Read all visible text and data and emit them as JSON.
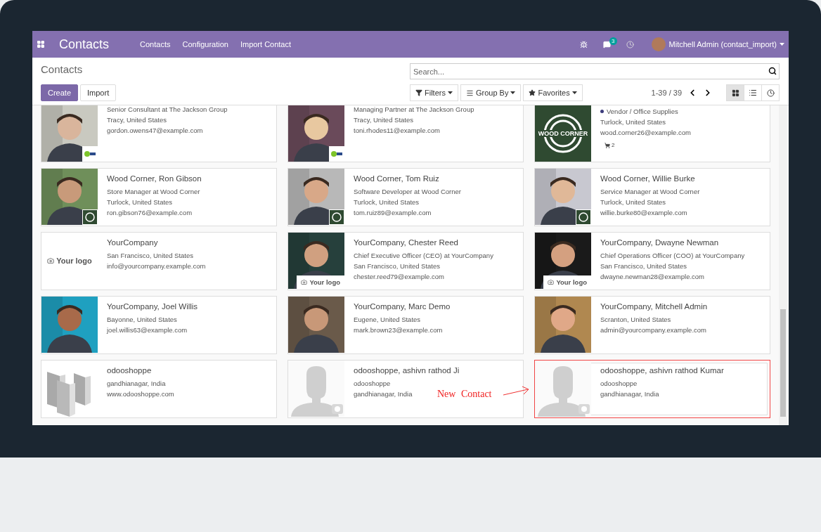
{
  "navbar": {
    "app_title": "Contacts",
    "menu": [
      "Contacts",
      "Configuration",
      "Import Contact"
    ],
    "messages_count": "3",
    "user": "Mitchell Admin (contact_import)"
  },
  "control_panel": {
    "breadcrumb": "Contacts",
    "buttons": [
      {
        "label": "Create",
        "kind": "primary"
      },
      {
        "label": "Import",
        "kind": "secondary"
      }
    ],
    "search": {
      "placeholder": "Search..."
    },
    "filters": [
      {
        "label": "Filters",
        "kind": "filter"
      },
      {
        "label": "Group By",
        "kind": "group"
      },
      {
        "label": "Favorites",
        "kind": "favorite"
      }
    ],
    "pager": "1-39 / 39",
    "views": [
      {
        "kind": "kanban",
        "selected": true
      },
      {
        "kind": "list",
        "selected": false
      },
      {
        "kind": "activity",
        "selected": false
      }
    ]
  },
  "cards": [
    {
      "badge": {
        "kind": "logo"
      },
      "lines": [
        "Senior Consultant at The Jackson Group",
        "Tracy, United States",
        "gordon.owens47@example.com"
      ],
      "highlighted": false
    },
    {
      "badge": {
        "kind": "logo"
      },
      "lines": [
        "Managing Partner at The Jackson Group",
        "Tracy, United States",
        "toni.rhodes11@example.com"
      ],
      "highlighted": false
    },
    {
      "kind": "wood_corner",
      "logo_text": "WOOD CORNER",
      "category": "Vendor / Office Supplies",
      "lines": [
        "Turlock, United States",
        "wood.corner26@example.com"
      ],
      "orders": "2",
      "highlighted": false
    },
    {
      "badge": {
        "kind": "seal"
      },
      "name": "Wood Corner, Ron Gibson",
      "lines": [
        "Store Manager at Wood Corner",
        "Turlock, United States",
        "ron.gibson76@example.com"
      ],
      "highlighted": false
    },
    {
      "badge": {
        "kind": "seal"
      },
      "name": "Wood Corner, Tom Ruiz",
      "lines": [
        "Software Developer at Wood Corner",
        "Turlock, United States",
        "tom.ruiz89@example.com"
      ],
      "highlighted": false
    },
    {
      "badge": {
        "kind": "seal"
      },
      "name": "Wood Corner, Willie Burke",
      "lines": [
        "Service Manager at Wood Corner",
        "Turlock, United States",
        "willie.burke80@example.com"
      ],
      "highlighted": false
    },
    {
      "kind": "your_logo",
      "logo_text": "Your logo",
      "name": "YourCompany",
      "lines": [
        "San Francisco, United States",
        "info@yourcompany.example.com"
      ],
      "highlighted": false
    },
    {
      "badge": {
        "kind": "text",
        "text": "Your logo"
      },
      "name": "YourCompany, Chester Reed",
      "lines": [
        "Chief Executive Officer (CEO) at YourCompany",
        "San Francisco, United States",
        "chester.reed79@example.com"
      ],
      "highlighted": false
    },
    {
      "badge": {
        "kind": "text",
        "text": "Your logo"
      },
      "name": "YourCompany, Dwayne Newman",
      "lines": [
        "Chief Operations Officer (COO) at YourCompany",
        "San Francisco, United States",
        "dwayne.newman28@example.com"
      ],
      "highlighted": false
    },
    {
      "name": "YourCompany, Joel Willis",
      "lines": [
        "Bayonne, United States",
        "joel.willis63@example.com"
      ],
      "highlighted": false
    },
    {
      "name": "YourCompany, Marc Demo",
      "lines": [
        "Eugene, United States",
        "mark.brown23@example.com"
      ],
      "highlighted": false
    },
    {
      "name": "YourCompany, Mitchell Admin",
      "lines": [
        "Scranton, United States",
        "admin@yourcompany.example.com"
      ],
      "highlighted": false
    },
    {
      "kind": "buildings",
      "name": "odooshoppe",
      "lines": [
        "gandhianagar, India",
        "www.odooshoppe.com"
      ],
      "highlighted": false
    },
    {
      "kind": "avatar",
      "name": "odooshoppe, ashivn rathod Ji",
      "lines": [
        "odooshoppe",
        "gandhianagar, India"
      ],
      "highlighted": false
    },
    {
      "kind": "avatar",
      "name": "odooshoppe, ashivn rathod Kumar",
      "lines": [
        "odooshoppe",
        "gandhianagar, India"
      ],
      "highlighted": true
    }
  ],
  "annotation": {
    "text": "New Contact"
  }
}
